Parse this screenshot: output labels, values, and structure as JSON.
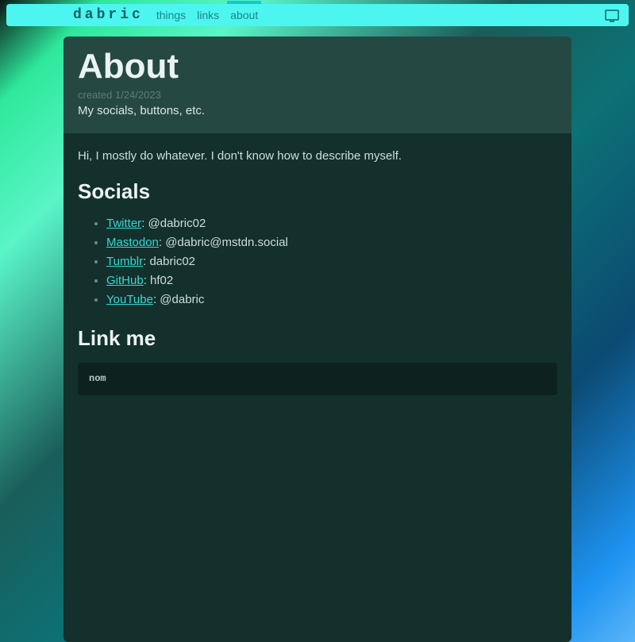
{
  "nav": {
    "brand": "dabric",
    "links": [
      {
        "label": "things",
        "active": false
      },
      {
        "label": "links",
        "active": false
      },
      {
        "label": "about",
        "active": true
      }
    ]
  },
  "page": {
    "title": "About",
    "created_prefix": "created ",
    "created_date": "1/24/2023",
    "subtitle": "My socials, buttons, etc."
  },
  "content": {
    "intro": "Hi, I mostly do whatever. I don't know how to describe myself.",
    "socials_heading": "Socials",
    "socials": [
      {
        "site": "Twitter",
        "handle": ": @dabric02"
      },
      {
        "site": "Mastodon",
        "handle": ": @dabric@mstdn.social"
      },
      {
        "site": "Tumblr",
        "handle": ": dabric02"
      },
      {
        "site": "GitHub",
        "handle": ": hf02"
      },
      {
        "site": "YouTube",
        "handle": ": @dabric"
      }
    ],
    "linkme_heading": "Link me",
    "code": "nom"
  }
}
